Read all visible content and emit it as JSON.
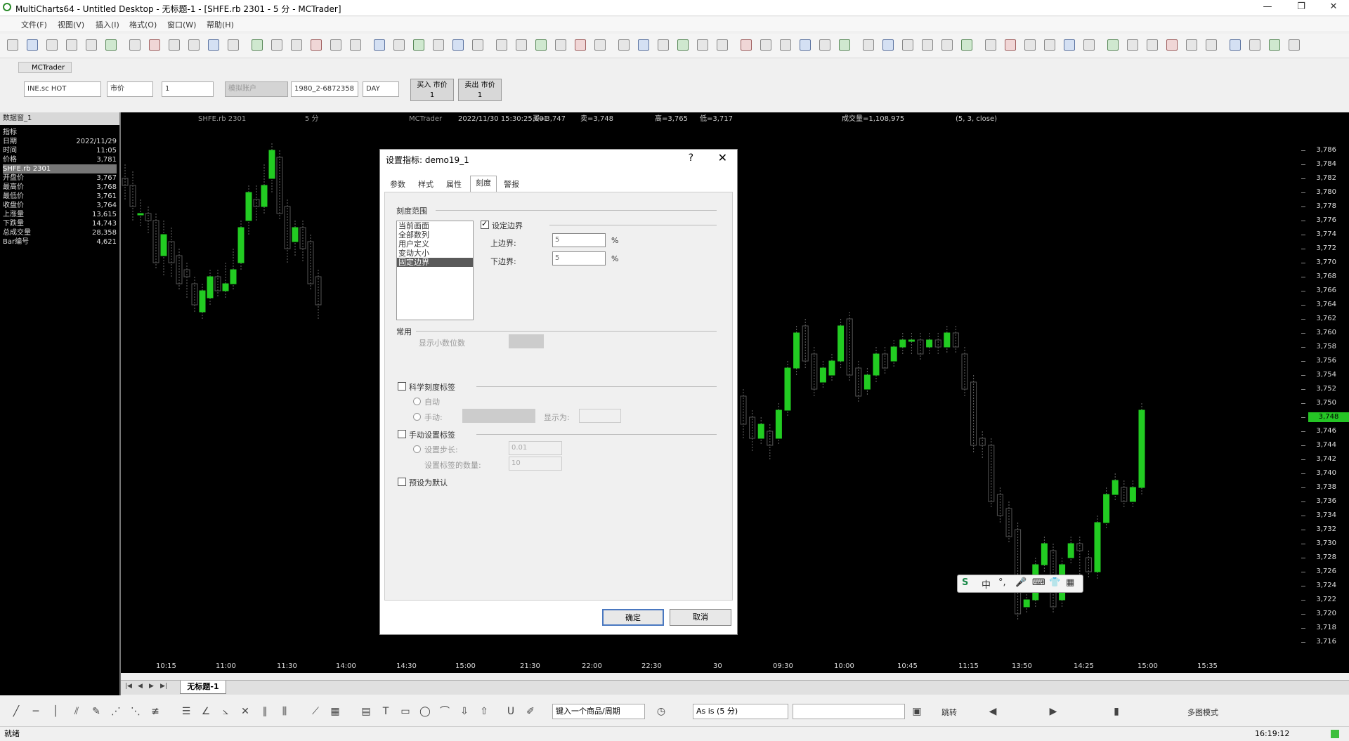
{
  "window": {
    "title": "MultiCharts64 - Untitled Desktop - 无标题-1 - [SHFE.rb 2301 - 5 分 - MCTrader]",
    "minimize": "—",
    "maximize": "❐",
    "close": "✕"
  },
  "menu": [
    "文件(F)",
    "视图(V)",
    "插入(I)",
    "格式(O)",
    "窗口(W)",
    "帮助(H)"
  ],
  "tradebar": {
    "tab_label": "MCTrader",
    "symbol": "INE.sc HOT",
    "order_type": "市价",
    "quantity": "1",
    "account_disabled": "模拟账户",
    "account": "1980_2-6872358",
    "tif": "DAY",
    "buy_label": "买入 市价",
    "buy_qty": "1",
    "sell_label": "卖出 市价",
    "sell_qty": "1"
  },
  "datawindow": {
    "header": "数据窗_1",
    "rows": [
      {
        "label": "指标",
        "value": ""
      },
      {
        "label": "日期",
        "value": "2022/11/29"
      },
      {
        "label": "时间",
        "value": "11:05"
      },
      {
        "label": "价格",
        "value": "3,781"
      },
      {
        "label": "SHFE.rb 2301",
        "value": "",
        "selected": true
      },
      {
        "label": "开盘价",
        "value": "3,767"
      },
      {
        "label": "最高价",
        "value": "3,768"
      },
      {
        "label": "最低价",
        "value": "3,761"
      },
      {
        "label": "收盘价",
        "value": "3,764"
      },
      {
        "label": "上涨量",
        "value": "13,615"
      },
      {
        "label": "下跌量",
        "value": "14,743"
      },
      {
        "label": "总成交量",
        "value": "28,358"
      },
      {
        "label": "Bar编号",
        "value": "4,621"
      }
    ]
  },
  "chartinfo": {
    "symbol": "SHFE.rb 2301",
    "freq": "5 分",
    "source": "MCTrader",
    "datetime": "2022/11/30 15:30:25.001",
    "bid": "买=3,747",
    "ask": "卖=3,748",
    "high": "高=3,765",
    "low": "低=3,717",
    "volume": "成交量=1,108,975",
    "indicator": "(5, 3, close)"
  },
  "yaxis": [
    "3,786",
    "3,784",
    "3,782",
    "3,780",
    "3,778",
    "3,776",
    "3,774",
    "3,772",
    "3,770",
    "3,768",
    "3,766",
    "3,764",
    "3,762",
    "3,760",
    "3,758",
    "3,756",
    "3,754",
    "3,752",
    "3,750",
    "3,748",
    "3,746",
    "3,744",
    "3,742",
    "3,740",
    "3,738",
    "3,736",
    "3,734",
    "3,732",
    "3,730",
    "3,728",
    "3,726",
    "3,724",
    "3,722",
    "3,720",
    "3,718",
    "3,716"
  ],
  "current_price": "3,748",
  "xaxis": [
    "10:15",
    "11:00",
    "11:30",
    "14:00",
    "14:30",
    "15:00",
    "21:30",
    "22:00",
    "22:30",
    "30",
    "09:30",
    "10:00",
    "10:45",
    "11:15",
    "13:50",
    "14:25",
    "15:00",
    "15:35"
  ],
  "chart_sheet_tab": "无标题-1",
  "dialog": {
    "title": "设置指标: demo19_1",
    "help": "?",
    "close": "✕",
    "tabs": [
      "参数",
      "样式",
      "属性",
      "刻度",
      "警报"
    ],
    "active_tab": "刻度",
    "scale_range_label": "刻度范围",
    "range_options": [
      "当前画面",
      "全部数列",
      "用户定义",
      "变动大小",
      "固定边界"
    ],
    "fixed_bounds_label": "设定边界",
    "upper_label": "上边界:",
    "upper_value": "5",
    "lower_label": "下边界:",
    "lower_value": "5",
    "percent": "%",
    "common_label": "常用",
    "decimals_label": "显示小数位数",
    "sci_label": "科学刻度标签",
    "auto_label": "自动",
    "manual_label": "手动:",
    "display_label": "显示为:",
    "manual_tick_label": "手动设置标签",
    "step_label": "设置步长:",
    "step_value": "0.01",
    "count_label": "设置标签的数量:",
    "count_value": "10",
    "default_label": "预设为默认",
    "ok": "确定",
    "cancel": "取消"
  },
  "drawbar": {
    "symbol_combo": "键入一个商品/周期",
    "asis_combo": "As is (5 分)",
    "jump": "跳转",
    "multi_mode": "多图模式"
  },
  "status": {
    "left": "就绪",
    "time": "16:19:12"
  },
  "ime": [
    "S",
    "中",
    "°,",
    "🎤",
    "⌨",
    "👕",
    "▦"
  ],
  "colors": {
    "bull": "#22cc22",
    "bear": "#555555",
    "background": "#000000"
  }
}
